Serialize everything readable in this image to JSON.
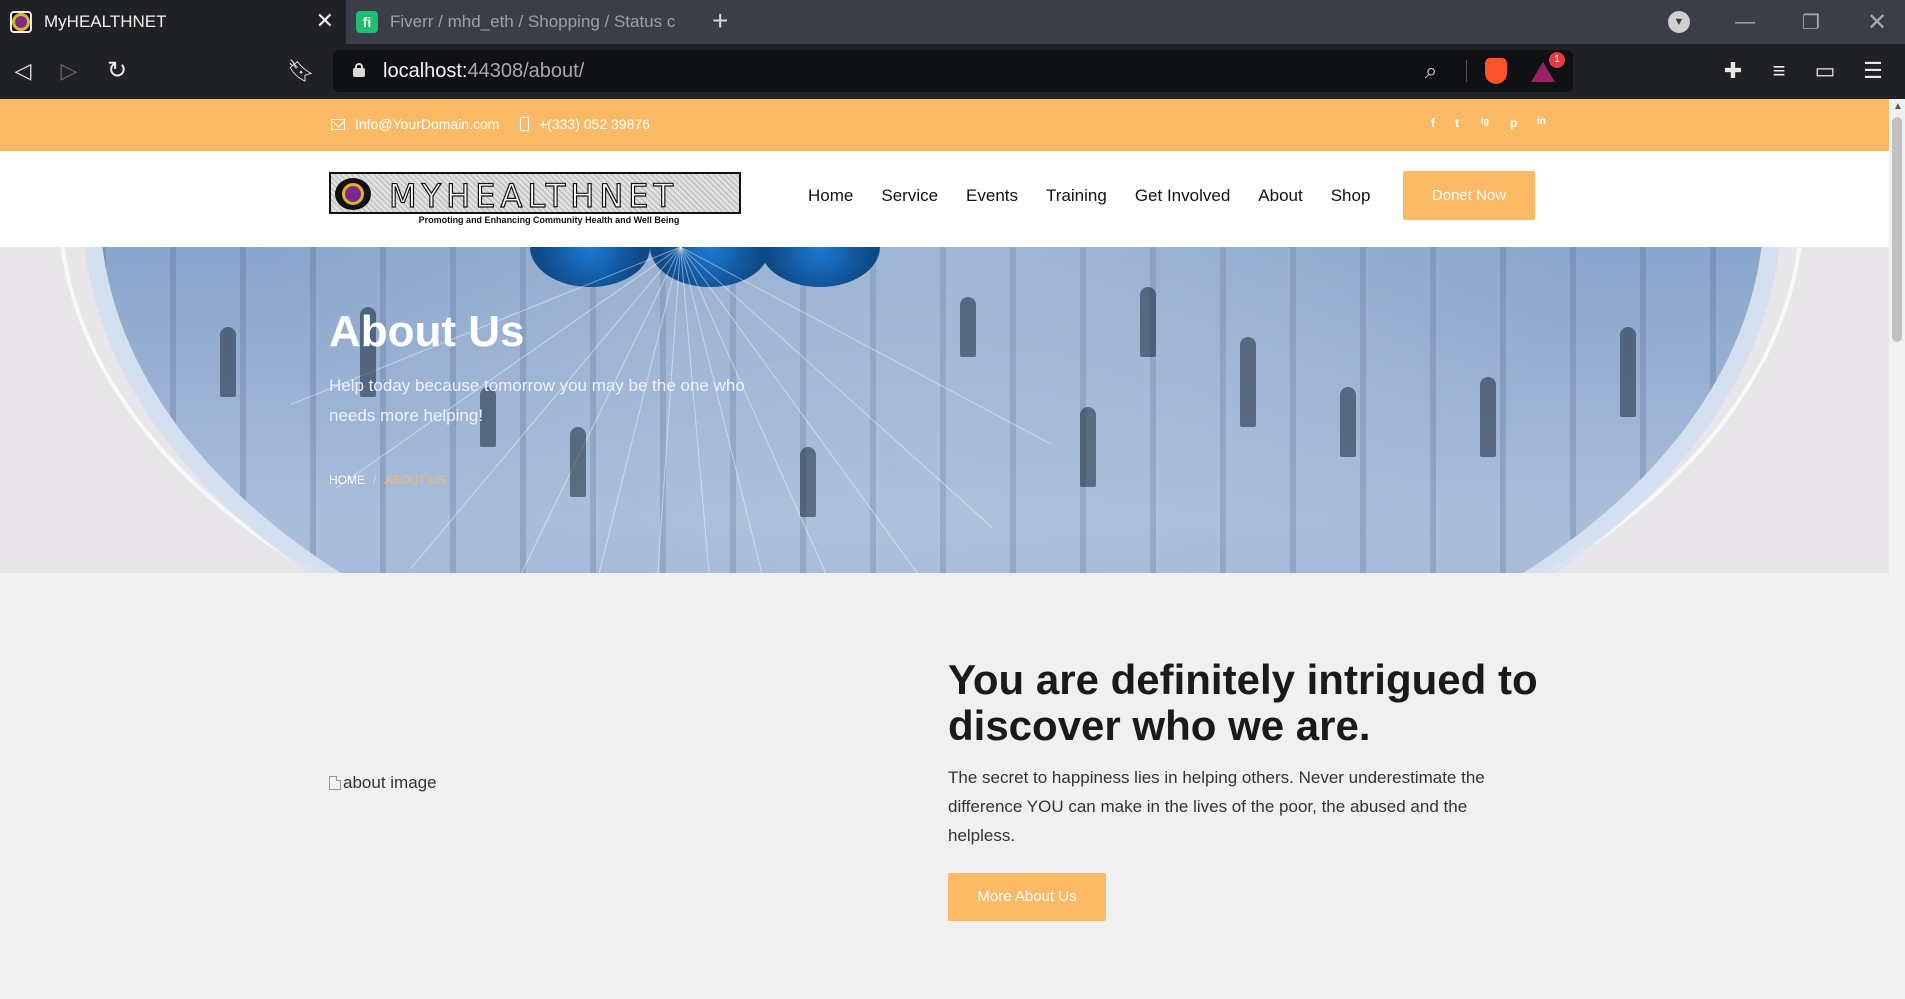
{
  "browser": {
    "tabs": [
      {
        "title": "MyHEALTHNET",
        "active": true,
        "icon": "myhealthnet-favicon"
      },
      {
        "title": "Fiverr / mhd_eth / Shopping / Status c",
        "active": false,
        "icon": "fiverr-favicon"
      }
    ],
    "url_host": "localhost:",
    "url_rest": "44308/about/",
    "bat_badge": "1",
    "fiverr_glyph": "fi"
  },
  "topbar": {
    "email": "Info@YourDomain.com",
    "phone": "+(333) 052 39876",
    "social": [
      "f",
      "t",
      "ig",
      "p",
      "in"
    ]
  },
  "nav": {
    "logo_text": "MYHEALTHNET",
    "logo_tagline": "Promoting and Enhancing Community Health and Well Being",
    "links": [
      "Home",
      "Service",
      "Events",
      "Training",
      "Get Involved",
      "About",
      "Shop"
    ],
    "donate": "Donet Now"
  },
  "banner": {
    "title": "About Us",
    "subtitle": "Help today because tomorrow you may be the one who needs more helping!",
    "crumb_home": "HOME",
    "crumb_sep": "/",
    "crumb_current": "ABOUT US"
  },
  "about": {
    "image_alt": "about image",
    "heading": "You are definitely intrigued to discover who we are.",
    "text": "The secret to happiness lies in helping others. Never underestimate the difference YOU can make in the lives of the poor, the abused and the helpless.",
    "button": "More About Us"
  },
  "colors": {
    "accent": "#f9b965",
    "chrome_dark": "#202124",
    "tabbar": "#3b3d49"
  }
}
